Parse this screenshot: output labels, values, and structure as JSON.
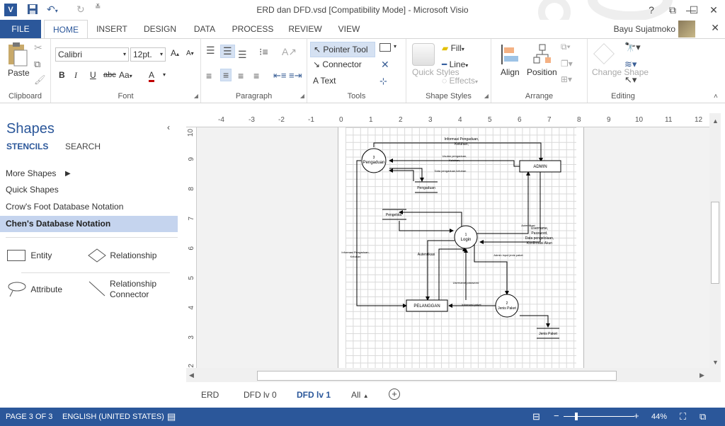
{
  "titlebar": {
    "app_icon": "V",
    "title": "ERD dan DFD.vsd  [Compatibility Mode] - Microsoft Visio",
    "help": "?",
    "minimize": "—",
    "restore": "☐",
    "close": "✕"
  },
  "ribbon_tabs": {
    "file": "FILE",
    "home": "HOME",
    "insert": "INSERT",
    "design": "DESIGN",
    "data": "DATA",
    "process": "PROCESS",
    "review": "REVIEW",
    "view": "VIEW"
  },
  "user": {
    "name": "Bayu Sujatmoko"
  },
  "ribbon": {
    "clipboard": {
      "paste": "Paste",
      "label": "Clipboard"
    },
    "font": {
      "family": "Calibri",
      "size": "12pt.",
      "label": "Font",
      "bold": "B",
      "italic": "I",
      "underline": "U",
      "strike": "abc",
      "case": "Aa",
      "color": "A"
    },
    "paragraph": {
      "label": "Paragraph"
    },
    "tools": {
      "pointer": "Pointer Tool",
      "connector": "Connector",
      "text": "Text",
      "label": "Tools"
    },
    "shape_styles": {
      "quick_styles": "Quick Styles",
      "fill": "Fill",
      "line": "Line",
      "effects": "Effects",
      "label": "Shape Styles"
    },
    "arrange": {
      "align": "Align",
      "position": "Position",
      "label": "Arrange"
    },
    "editing": {
      "change_shape": "Change Shape",
      "label": "Editing"
    }
  },
  "shapes_pane": {
    "title": "Shapes",
    "tab_stencils": "STENCILS",
    "tab_search": "SEARCH",
    "more_shapes": "More Shapes",
    "stencils": [
      "Quick Shapes",
      "Crow's Foot Database Notation",
      "Chen's Database Notation"
    ],
    "shapes": {
      "entity": "Entity",
      "relationship": "Relationship",
      "attribute": "Attribute",
      "relationship_connector_1": "Relationship",
      "relationship_connector_2": "Connector"
    }
  },
  "rulers": {
    "h": [
      "-4",
      "-3",
      "-2",
      "-1",
      "0",
      "1",
      "2",
      "3",
      "4",
      "5",
      "6",
      "7",
      "8",
      "9",
      "10",
      "11",
      "12"
    ],
    "v": [
      "10",
      "9",
      "8",
      "7",
      "6",
      "5",
      "4",
      "3",
      "2"
    ]
  },
  "diagram": {
    "p3_num": "3",
    "p3_name": "Pengaduan",
    "admin": "ADMIN",
    "pengaduan_store": "Pengaduan",
    "pengelola_store": "Pengelola",
    "p1_num": "1",
    "p1_name": "Login",
    "pelanggan": "PELANGGAN",
    "p2_num": "2",
    "p2_name": "Jenis Paket",
    "jenis_store": "Jenis Paket",
    "l_info_top_1": "Informasi Pengaduan,",
    "l_info_top_2": "Keluhan,",
    "l_usulan_1": "Usulan pengaduan,",
    "l_usulan_2": "Keluhan,",
    "l_data_peng": "Data pengaduan,keluhan",
    "l_info_left_1": "Informasi Pengaduan,",
    "l_info_left_2": "Keluhan",
    "l_autentikasi_admin": "Autentikasi",
    "l_username": "Username,",
    "l_password": "Password,",
    "l_data_pengelola": "Data pengelolaan,",
    "l_konfirmasi": "Konfirmasi Akun",
    "l_autentikasi": "Autentikasi",
    "l_username_pw": "Username password",
    "l_info_paket": "Informasi paket",
    "l_admin_input": "Admin input jenis paket"
  },
  "sheet_tabs": [
    "ERD",
    "DFD lv 0",
    "DFD lv 1",
    "All"
  ],
  "statusbar": {
    "page": "PAGE 3 OF 3",
    "language": "ENGLISH (UNITED STATES)",
    "zoom": "44%"
  },
  "colors": {
    "accent": "#2b579a",
    "selected_stencil": "#c5d4ee"
  }
}
